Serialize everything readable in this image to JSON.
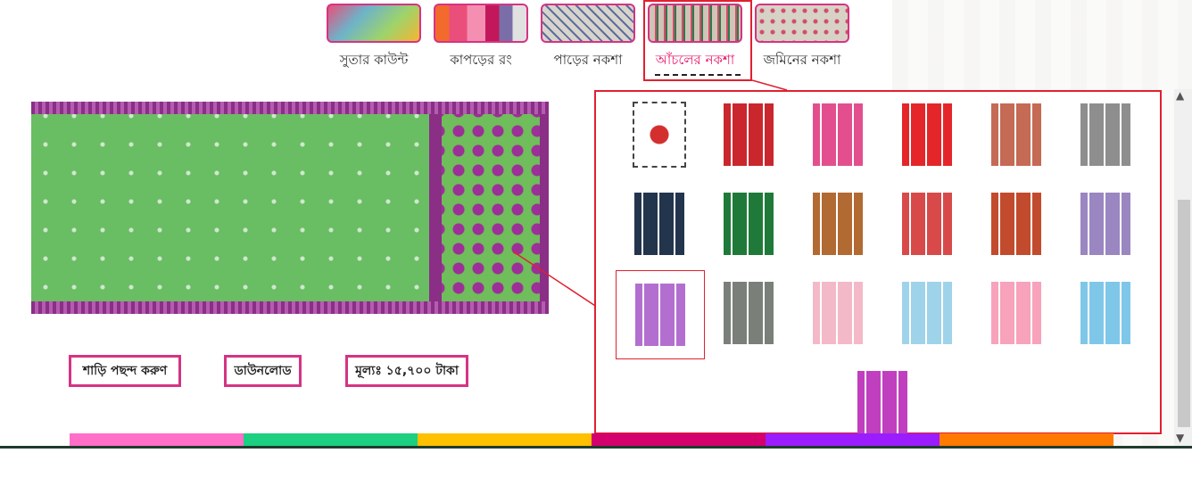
{
  "tabs": [
    {
      "label": "সুতার কাউন্ট",
      "icon": "yarn-thumbnail",
      "color": "#6db3c9"
    },
    {
      "label": "কাপড়ের রং",
      "icon": "fabric-colors-thumbnail",
      "color": "#e94f7a"
    },
    {
      "label": "পাড়ের নকশা",
      "icon": "border-pattern-thumbnail",
      "color": "#d9d4cb"
    },
    {
      "label": "আঁচলের নকশা",
      "icon": "anchal-pattern-thumbnail",
      "color": "#cfc4b5",
      "active": true
    },
    {
      "label": "জমিনের নকশা",
      "icon": "jamin-pattern-thumbnail",
      "color": "#d7d2c6"
    }
  ],
  "actions": {
    "choose_saree": "শাড়ি পছন্দ করুণ",
    "download": "ডাউনলোড",
    "price": "মূল্যঃ ১৫,৭০০ টাকা"
  },
  "gallery": {
    "items": [
      {
        "name": "logo-tile",
        "color": "#ffffff"
      },
      {
        "name": "red-paisley",
        "color": "#c9272d"
      },
      {
        "name": "pink-paisley",
        "color": "#e34f8e"
      },
      {
        "name": "red-plain",
        "color": "#e4262a"
      },
      {
        "name": "cream-red-floral",
        "color": "#c56a55"
      },
      {
        "name": "grey-medallion",
        "color": "#8e8e8e"
      },
      {
        "name": "navy-gold",
        "color": "#23344d"
      },
      {
        "name": "green-lattice",
        "color": "#1f7a3a"
      },
      {
        "name": "brown-diamond",
        "color": "#b26a33"
      },
      {
        "name": "red-teal-block",
        "color": "#d84a4a"
      },
      {
        "name": "rust-stripe",
        "color": "#c24b2d"
      },
      {
        "name": "lavender-geo",
        "color": "#9a86c0"
      },
      {
        "name": "purple-white",
        "color": "#b36fcf",
        "selected": true
      },
      {
        "name": "grey-white",
        "color": "#7a7f7a"
      },
      {
        "name": "light-pink",
        "color": "#f3b9c8"
      },
      {
        "name": "light-blue",
        "color": "#9fd3ea"
      },
      {
        "name": "pink-lattice",
        "color": "#f6a3bb"
      },
      {
        "name": "blue-lattice",
        "color": "#7fc7e8"
      },
      {
        "name": "magenta-geo",
        "color": "#c03fbf"
      }
    ]
  },
  "color_strip": [
    "#ff6fc8",
    "#1bd080",
    "#ffc000",
    "#d4006d",
    "#9b1dff",
    "#ff7a00"
  ]
}
